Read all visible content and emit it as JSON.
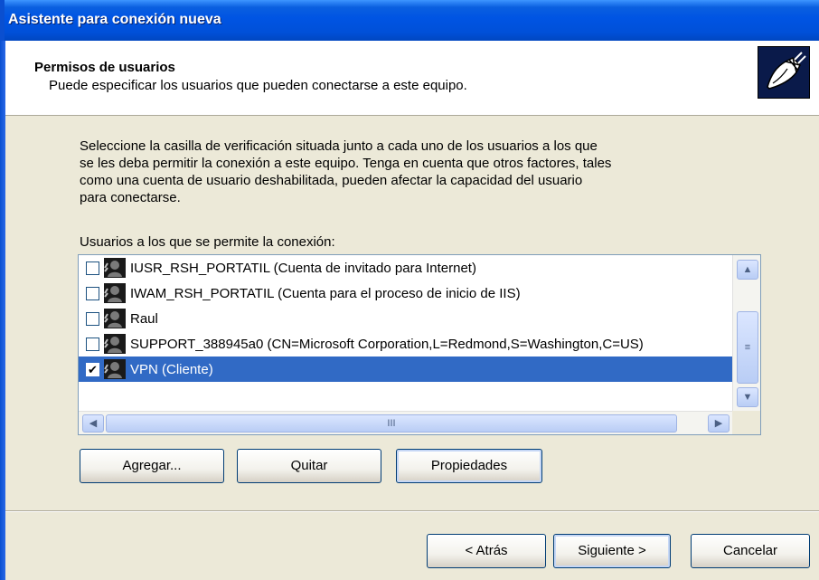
{
  "window": {
    "title": "Asistente para conexión nueva"
  },
  "header": {
    "title": "Permisos de usuarios",
    "subtitle": "Puede especificar los usuarios que pueden conectarse a este equipo."
  },
  "description": [
    "Seleccione la casilla de verificación situada junto a cada uno de los usuarios a los que",
    "se les deba permitir la conexión a este equipo. Tenga en cuenta que otros factores, tales",
    "como una cuenta de usuario deshabilitada, pueden afectar la capacidad del usuario",
    "para conectarse."
  ],
  "users_list": {
    "label": "Usuarios a los que se permite la conexión:",
    "items": [
      {
        "name": "IUSR_RSH_PORTATIL (Cuenta de invitado para Internet)",
        "checked": false,
        "selected": false
      },
      {
        "name": "IWAM_RSH_PORTATIL (Cuenta para el proceso de inicio de IIS)",
        "checked": false,
        "selected": false
      },
      {
        "name": "Raul",
        "checked": false,
        "selected": false
      },
      {
        "name": "SUPPORT_388945a0 (CN=Microsoft Corporation,L=Redmond,S=Washington,C=US)",
        "checked": false,
        "selected": false
      },
      {
        "name": "VPN (Cliente)",
        "checked": true,
        "selected": true
      }
    ],
    "scroll_glyph": "III"
  },
  "list_buttons": {
    "add": "Agregar...",
    "remove": "Quitar",
    "properties": "Propiedades"
  },
  "nav_buttons": {
    "back": "< Atrás",
    "next": "Siguiente >",
    "cancel": "Cancelar"
  },
  "colors": {
    "title_bar": "#0054e3",
    "selection": "#316ac5",
    "dialog_bg": "#ece9d8"
  },
  "icons": [
    "connection-wizard-icon",
    "user-icon",
    "scroll-up-icon",
    "scroll-down-icon",
    "scroll-left-icon",
    "scroll-right-icon"
  ]
}
